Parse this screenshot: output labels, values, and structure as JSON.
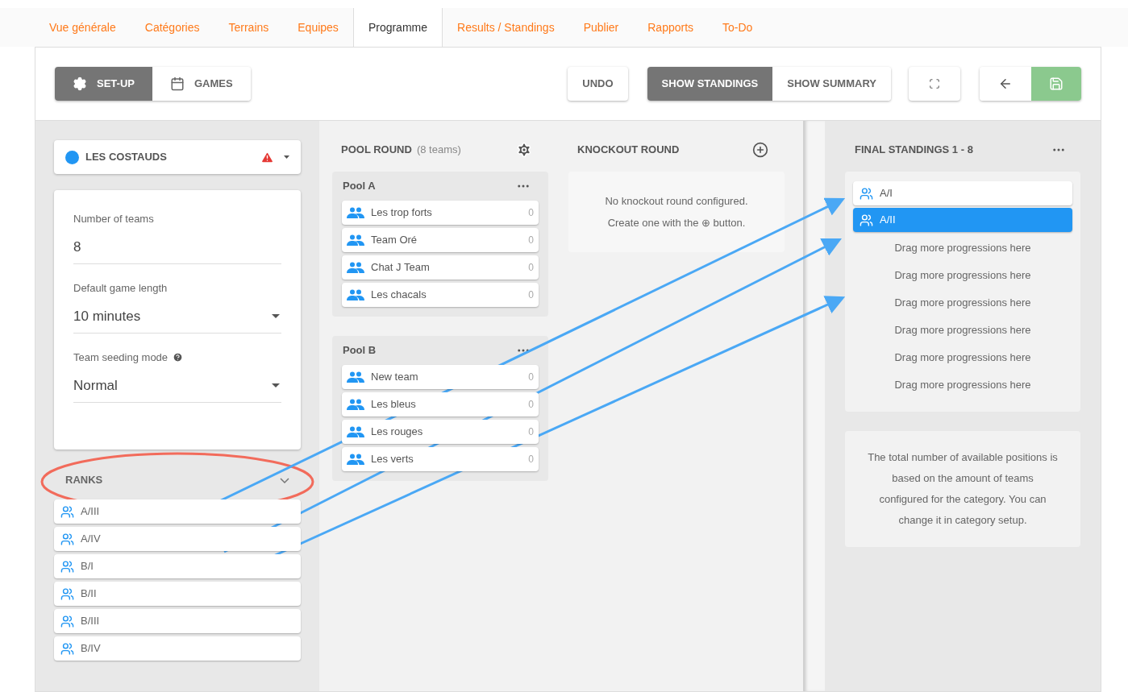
{
  "nav_tabs": [
    {
      "label": "Vue générale",
      "selected": false
    },
    {
      "label": "Catégories",
      "selected": false
    },
    {
      "label": "Terrains",
      "selected": false
    },
    {
      "label": "Equipes",
      "selected": false
    },
    {
      "label": "Programme",
      "selected": true
    },
    {
      "label": "Results / Standings",
      "selected": false
    },
    {
      "label": "Publier",
      "selected": false
    },
    {
      "label": "Rapports",
      "selected": false
    },
    {
      "label": "To-Do",
      "selected": false
    }
  ],
  "toolbar": {
    "mode_toggle": [
      {
        "kind": "setup",
        "label": "SET-UP",
        "selected": true
      },
      {
        "kind": "games",
        "label": "GAMES",
        "selected": false
      }
    ],
    "undo": "UNDO",
    "view_toggle": [
      {
        "label": "SHOW STANDINGS",
        "selected": true
      },
      {
        "label": "SHOW SUMMARY",
        "selected": false
      }
    ]
  },
  "category": {
    "name": "LES COSTAUDS",
    "color": "#2196f3",
    "warning": true
  },
  "settings": [
    {
      "kind": "text",
      "label": "Number of teams",
      "value": "8",
      "help": false
    },
    {
      "kind": "select",
      "label": "Default game length",
      "value": "10 minutes",
      "help": false
    },
    {
      "kind": "select",
      "label": "Team seeding mode",
      "value": "Normal",
      "help": true
    }
  ],
  "ranks": {
    "title": "RANKS",
    "expanded": true,
    "items": [
      "A/III",
      "A/IV",
      "B/I",
      "B/II",
      "B/III",
      "B/IV"
    ]
  },
  "pool_round": {
    "title": "POOL ROUND",
    "count": "(8 teams)",
    "pools": [
      {
        "name": "Pool A",
        "teams": [
          {
            "name": "Les trop forts",
            "score": "0"
          },
          {
            "name": "Team Oré",
            "score": "0"
          },
          {
            "name": "Chat J Team",
            "score": "0"
          },
          {
            "name": "Les chacals",
            "score": "0"
          }
        ]
      },
      {
        "name": "Pool B",
        "teams": [
          {
            "name": "New team",
            "score": "0"
          },
          {
            "name": "Les bleus",
            "score": "0"
          },
          {
            "name": "Les rouges",
            "score": "0"
          },
          {
            "name": "Les verts",
            "score": "0"
          }
        ]
      }
    ]
  },
  "knockout_round": {
    "title": "KNOCKOUT ROUND",
    "empty_message": [
      "No knockout round configured.",
      "Create one with the ⊕ button."
    ]
  },
  "final_standings": {
    "title": "FINAL STANDINGS 1 - 8",
    "entries": [
      {
        "label": "A/I",
        "selected": false
      },
      {
        "label": "A/II",
        "selected": true
      }
    ],
    "drop_hints": [
      "Drag more progressions here",
      "Drag more progressions here",
      "Drag more progressions here",
      "Drag more progressions here",
      "Drag more progressions here",
      "Drag more progressions here"
    ],
    "info": "The total number of available positions is based on the amount of teams configured for the category. You can change it in category setup."
  }
}
